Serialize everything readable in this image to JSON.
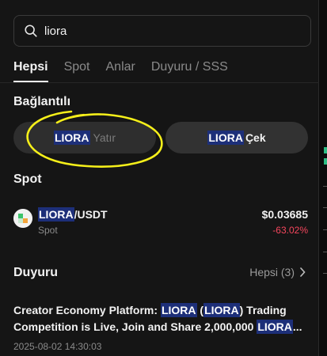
{
  "search": {
    "value": "liora"
  },
  "tabs": [
    {
      "label": "Hepsi"
    },
    {
      "label": "Spot"
    },
    {
      "label": "Anlar"
    },
    {
      "label": "Duyuru / SSS"
    }
  ],
  "connections": {
    "title": "Bağlantılı",
    "deposit": {
      "token": "LIORA",
      "action": "Yatır"
    },
    "withdraw": {
      "token": "LIORA",
      "action": "Çek"
    }
  },
  "spot": {
    "title": "Spot",
    "pair_base": "LIORA",
    "pair_quote": "/USDT",
    "market": "Spot",
    "price": "$0.03685",
    "change": "-63.02%"
  },
  "announcements": {
    "title": "Duyuru",
    "all_label": "Hepsi (3)",
    "item": {
      "part1": "Creator Economy Platform: ",
      "token1": "LIORA",
      "part2": " (",
      "token2": "LIORA",
      "part3": ") Trading Competition is Live, Join and Share 2,000,000 ",
      "token3": "LIORA",
      "ellipsis": "...",
      "timestamp": "2025-08-02 14:30:03"
    }
  },
  "colors": {
    "highlight": "#1d2f79",
    "negative": "#f6465d",
    "annotation": "#f5ef1a"
  }
}
